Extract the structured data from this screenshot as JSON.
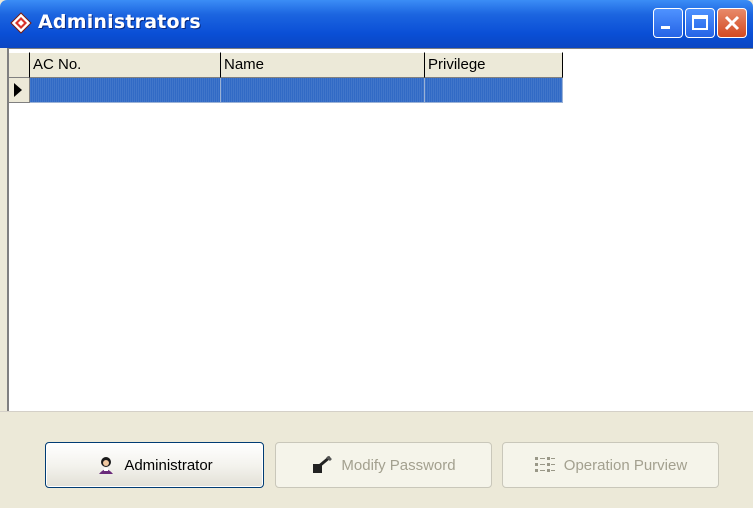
{
  "window": {
    "title": "Administrators"
  },
  "grid": {
    "columns": [
      "AC No.",
      "Name",
      "Privilege"
    ],
    "rows": [
      {
        "ac_no": "",
        "name": "",
        "privilege": "",
        "selected": true
      }
    ]
  },
  "buttons": {
    "administrator": "Administrator",
    "modify_password": "Modify Password",
    "operation_purview": "Operation Purview"
  },
  "colors": {
    "titlebar": "#0a4fd6",
    "selection": "#316ac5",
    "panel": "#ece9d8",
    "close_button": "#d24a22"
  },
  "icons": {
    "title": "app-diamond-icon",
    "administrator": "user-icon",
    "modify_password": "password-pencil-icon",
    "operation_purview": "list-tree-icon"
  }
}
